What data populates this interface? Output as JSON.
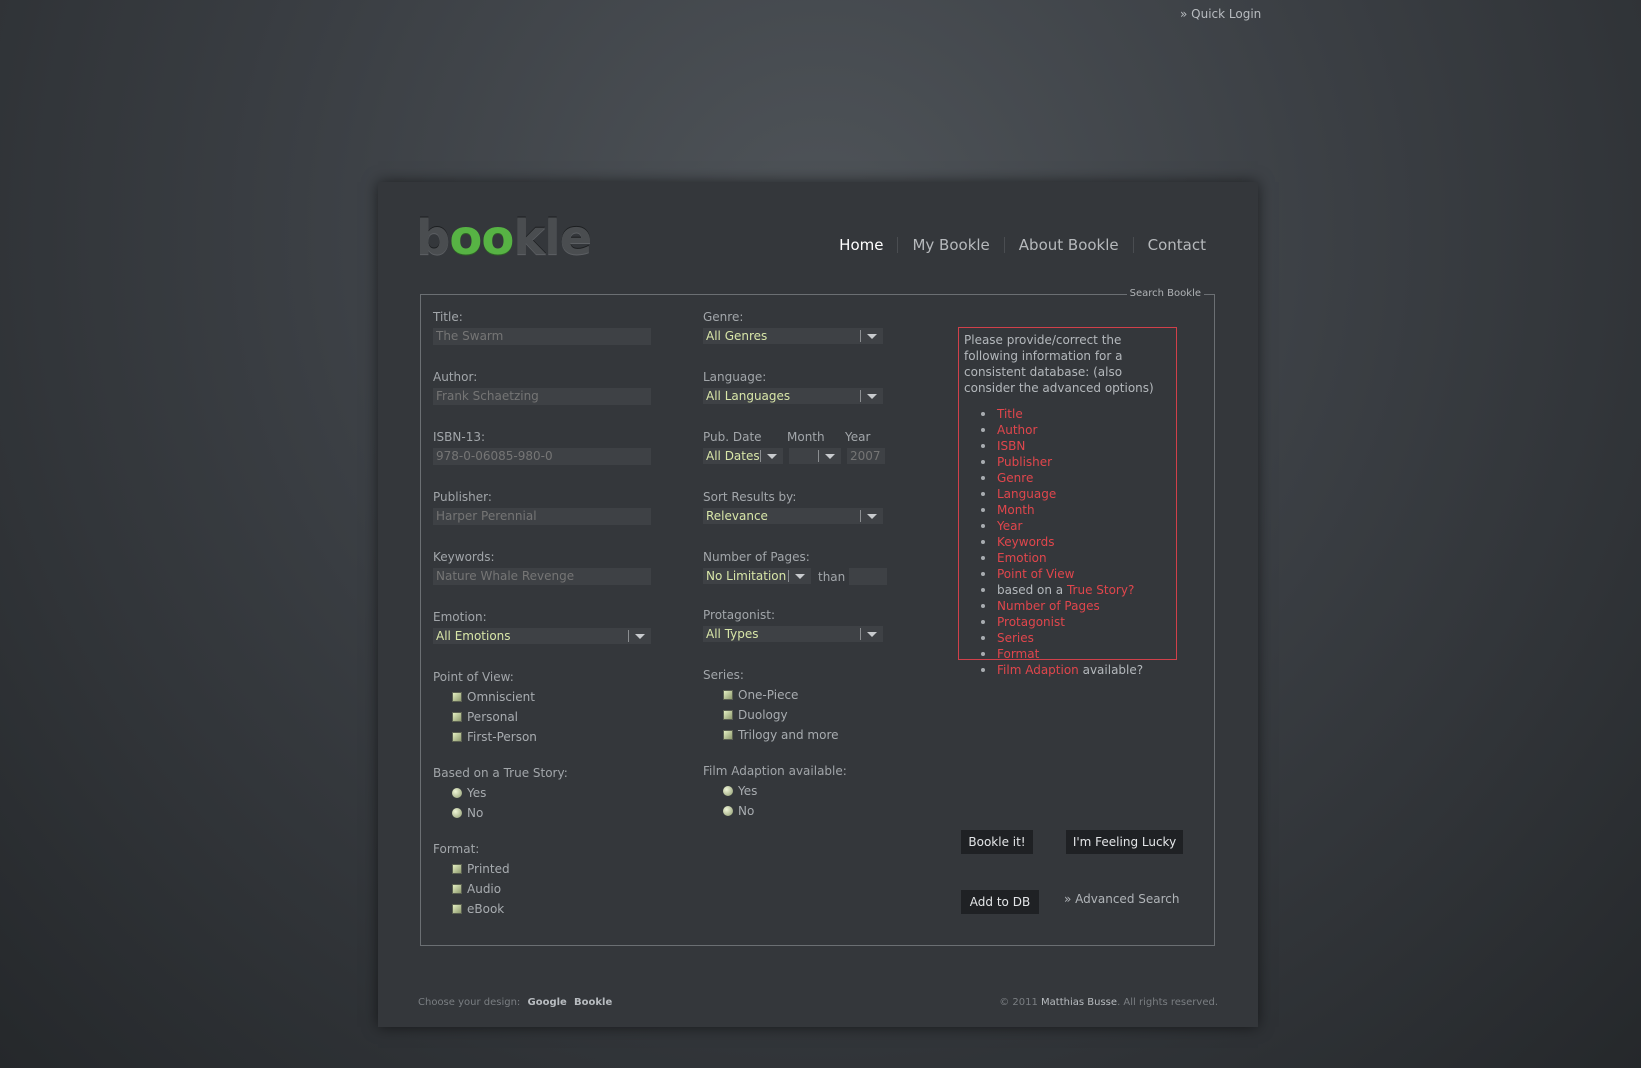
{
  "quick_login": "» Quick Login",
  "logo": {
    "b": "b",
    "oo": "oo",
    "kle": "kle"
  },
  "nav": [
    "Home",
    "My Bookle",
    "About Bookle",
    "Contact"
  ],
  "legend": "Search Bookle",
  "left": {
    "title": {
      "label": "Title:",
      "placeholder": "The Swarm"
    },
    "author": {
      "label": "Author:",
      "placeholder": "Frank Schaetzing"
    },
    "isbn": {
      "label": "ISBN-13:",
      "placeholder": "978-0-06085-980-0"
    },
    "publisher": {
      "label": "Publisher:",
      "placeholder": "Harper Perennial"
    },
    "keywords": {
      "label": "Keywords:",
      "placeholder": "Nature Whale Revenge"
    },
    "emotion": {
      "label": "Emotion:",
      "value": "All Emotions"
    },
    "pov": {
      "label": "Point of View:",
      "options": [
        "Omniscient",
        "Personal",
        "First-Person"
      ]
    },
    "true_story": {
      "label": "Based on a True Story:",
      "options": [
        "Yes",
        "No"
      ]
    },
    "format": {
      "label": "Format:",
      "options": [
        "Printed",
        "Audio",
        "eBook"
      ]
    }
  },
  "middle": {
    "genre": {
      "label": "Genre:",
      "value": "All Genres"
    },
    "language": {
      "label": "Language:",
      "value": "All Languages"
    },
    "pubdate": {
      "label": "Pub. Date",
      "month_label": "Month",
      "year_label": "Year",
      "value": "All Dates",
      "month_value": "",
      "year_placeholder": "2007"
    },
    "sort": {
      "label": "Sort Results by:",
      "value": "Relevance"
    },
    "pages": {
      "label": "Number of Pages:",
      "value": "No Limitation",
      "than": "than"
    },
    "protagonist": {
      "label": "Protagonist:",
      "value": "All Types"
    },
    "series": {
      "label": "Series:",
      "options": [
        "One-Piece",
        "Duology",
        "Trilogy and more"
      ]
    },
    "film": {
      "label": "Film Adaption available:",
      "options": [
        "Yes",
        "No"
      ]
    }
  },
  "info": {
    "intro": "Please provide/correct the following information for a consistent database: (also consider the advanced options)",
    "items": [
      {
        "pre": "",
        "red": "Title",
        "post": ""
      },
      {
        "pre": "",
        "red": "Author",
        "post": ""
      },
      {
        "pre": "",
        "red": "ISBN",
        "post": ""
      },
      {
        "pre": "",
        "red": "Publisher",
        "post": ""
      },
      {
        "pre": "",
        "red": "Genre",
        "post": ""
      },
      {
        "pre": "",
        "red": "Language",
        "post": ""
      },
      {
        "pre": "",
        "red": "Month",
        "post": ""
      },
      {
        "pre": "",
        "red": "Year",
        "post": ""
      },
      {
        "pre": "",
        "red": "Keywords",
        "post": ""
      },
      {
        "pre": "",
        "red": "Emotion",
        "post": ""
      },
      {
        "pre": "",
        "red": "Point of View",
        "post": ""
      },
      {
        "pre": "based on a ",
        "red": "True Story?",
        "post": ""
      },
      {
        "pre": "",
        "red": "Number of Pages",
        "post": ""
      },
      {
        "pre": "",
        "red": "Protagonist",
        "post": ""
      },
      {
        "pre": "",
        "red": "Series",
        "post": ""
      },
      {
        "pre": "",
        "red": "Format",
        "post": ""
      },
      {
        "pre": "",
        "red": "Film Adaption",
        "post": " available?"
      }
    ]
  },
  "buttons": {
    "bookle": "Bookle it!",
    "lucky": "I'm Feeling Lucky",
    "add": "Add to DB",
    "advanced": "» Advanced Search"
  },
  "footer": {
    "choose": "Choose your design:",
    "designs": [
      "Google",
      "Bookle"
    ],
    "copyright": "© 2011",
    "author": "Matthias Busse",
    "rights": ". All rights reserved."
  },
  "colors": {
    "accent_green": "#57b344",
    "error_red": "#e0464c",
    "select_text": "#d8e6a8"
  }
}
